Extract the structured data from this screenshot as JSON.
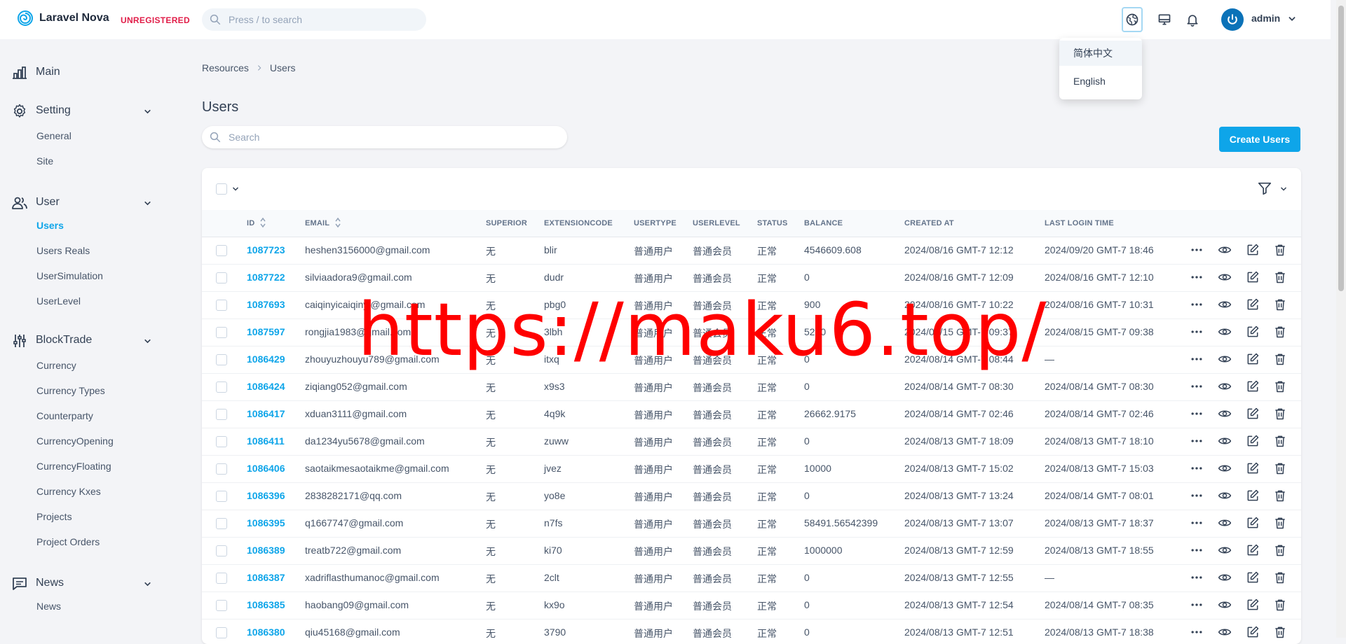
{
  "brand": {
    "name": "Laravel Nova",
    "badge": "UNREGISTERED"
  },
  "global_search": {
    "placeholder": "Press / to search"
  },
  "user_menu": {
    "name": "admin"
  },
  "language_menu": {
    "items": [
      "简体中文",
      "English"
    ]
  },
  "sidebar": {
    "sections": [
      {
        "label": "Main",
        "icon": "chart-bars-icon",
        "items": []
      },
      {
        "label": "Setting",
        "icon": "gear-icon",
        "items": [
          "General",
          "Site"
        ]
      },
      {
        "label": "User",
        "icon": "users-icon",
        "items": [
          "Users",
          "Users Reals",
          "UserSimulation",
          "UserLevel"
        ]
      },
      {
        "label": "BlockTrade",
        "icon": "sliders-icon",
        "items": [
          "Currency",
          "Currency Types",
          "Counterparty",
          "CurrencyOpening",
          "CurrencyFloating",
          "Currency Kxes",
          "Projects",
          "Project Orders"
        ]
      },
      {
        "label": "News",
        "icon": "chat-icon",
        "items": [
          "News"
        ]
      }
    ],
    "active_item": "Users"
  },
  "breadcrumb": [
    "Resources",
    "Users"
  ],
  "page_title": "Users",
  "resource_search": {
    "placeholder": "Search"
  },
  "create_button": "Create Users",
  "table": {
    "columns": [
      "ID",
      "EMAIL",
      "SUPERIOR",
      "EXTENSIONCODE",
      "USERTYPE",
      "USERLEVEL",
      "STATUS",
      "BALANCE",
      "CREATED AT",
      "LAST LOGIN TIME"
    ],
    "rows": [
      [
        "1087723",
        "heshen3156000@gmail.com",
        "无",
        "blir",
        "普通用户",
        "普通会员",
        "正常",
        "4546609.608",
        "2024/08/16 GMT-7 12:12",
        "2024/09/20 GMT-7 18:46"
      ],
      [
        "1087722",
        "silviaadora9@gmail.com",
        "无",
        "dudr",
        "普通用户",
        "普通会员",
        "正常",
        "0",
        "2024/08/16 GMT-7 12:09",
        "2024/08/16 GMT-7 12:10"
      ],
      [
        "1087693",
        "caiqinyicaiqinyi@gmail.com",
        "无",
        "pbg0",
        "普通用户",
        "普通会员",
        "正常",
        "900",
        "2024/08/16 GMT-7 10:22",
        "2024/08/16 GMT-7 10:31"
      ],
      [
        "1087597",
        "rongjia1983@gmail.com",
        "无",
        "3lbh",
        "普通用户",
        "普通会员",
        "正常",
        "5200",
        "2024/08/15 GMT-7 09:37",
        "2024/08/15 GMT-7 09:38"
      ],
      [
        "1086429",
        "zhouyuzhouyu789@gmail.com",
        "无",
        "itxq",
        "普通用户",
        "普通会员",
        "正常",
        "0",
        "2024/08/14 GMT-7 08:44",
        "—"
      ],
      [
        "1086424",
        "ziqiang052@gmail.com",
        "无",
        "x9s3",
        "普通用户",
        "普通会员",
        "正常",
        "0",
        "2024/08/14 GMT-7 08:30",
        "2024/08/14 GMT-7 08:30"
      ],
      [
        "1086417",
        "xduan3111@gmail.com",
        "无",
        "4q9k",
        "普通用户",
        "普通会员",
        "正常",
        "26662.9175",
        "2024/08/14 GMT-7 02:46",
        "2024/08/14 GMT-7 02:46"
      ],
      [
        "1086411",
        "da1234yu5678@gmail.com",
        "无",
        "zuww",
        "普通用户",
        "普通会员",
        "正常",
        "0",
        "2024/08/13 GMT-7 18:09",
        "2024/08/13 GMT-7 18:10"
      ],
      [
        "1086406",
        "saotaikmesaotaikme@gmail.com",
        "无",
        "jvez",
        "普通用户",
        "普通会员",
        "正常",
        "10000",
        "2024/08/13 GMT-7 15:02",
        "2024/08/13 GMT-7 15:03"
      ],
      [
        "1086396",
        "2838282171@qq.com",
        "无",
        "yo8e",
        "普通用户",
        "普通会员",
        "正常",
        "0",
        "2024/08/13 GMT-7 13:24",
        "2024/08/14 GMT-7 08:01"
      ],
      [
        "1086395",
        "q1667747@gmail.com",
        "无",
        "n7fs",
        "普通用户",
        "普通会员",
        "正常",
        "58491.56542399",
        "2024/08/13 GMT-7 13:07",
        "2024/08/13 GMT-7 18:37"
      ],
      [
        "1086389",
        "treatb722@gmail.com",
        "无",
        "ki70",
        "普通用户",
        "普通会员",
        "正常",
        "1000000",
        "2024/08/13 GMT-7 12:59",
        "2024/08/13 GMT-7 18:55"
      ],
      [
        "1086387",
        "xadriflasthumanoc@gmail.com",
        "无",
        "2clt",
        "普通用户",
        "普通会员",
        "正常",
        "0",
        "2024/08/13 GMT-7 12:55",
        "—"
      ],
      [
        "1086385",
        "haobang09@gmail.com",
        "无",
        "kx9o",
        "普通用户",
        "普通会员",
        "正常",
        "0",
        "2024/08/13 GMT-7 12:54",
        "2024/08/14 GMT-7 08:35"
      ],
      [
        "1086380",
        "qiu45168@gmail.com",
        "无",
        "3790",
        "普通用户",
        "普通会员",
        "正常",
        "0",
        "2024/08/13 GMT-7 12:51",
        "2024/08/13 GMT-7 18:38"
      ]
    ]
  },
  "watermark": "https://maku6.top/",
  "colors": {
    "accent": "#0ea5e9",
    "badge": "#e11d48",
    "watermark": "#ff0000"
  }
}
